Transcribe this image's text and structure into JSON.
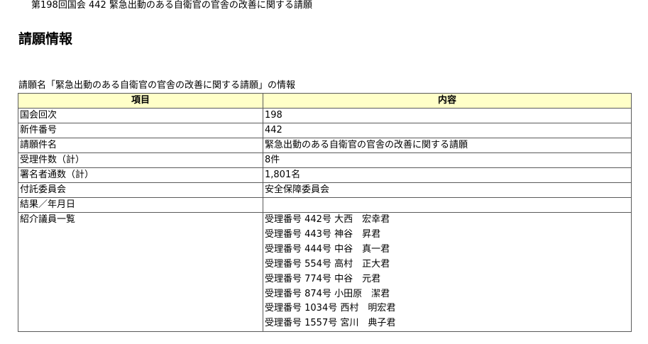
{
  "page": {
    "top_title": "第198回国会 442 緊急出動のある自衛官の官舎の改善に関する請願",
    "heading": "請願情報",
    "caption": "請願名「緊急出動のある自衛官の官舎の改善に関する請願」の情報"
  },
  "table": {
    "headers": {
      "item": "項目",
      "content": "内容"
    },
    "rows": [
      {
        "item": "国会回次",
        "content": "198"
      },
      {
        "item": "新件番号",
        "content": "442"
      },
      {
        "item": "請願件名",
        "content": "緊急出動のある自衛官の官舎の改善に関する請願"
      },
      {
        "item": "受理件数（計）",
        "content": "8件"
      },
      {
        "item": "署名者通数（計）",
        "content": "1,801名"
      },
      {
        "item": "付託委員会",
        "content": "安全保障委員会"
      },
      {
        "item": "結果／年月日",
        "content": ""
      }
    ],
    "members_row": {
      "item": "紹介議員一覧",
      "entries": [
        "受理番号 442号 大西　宏幸君",
        "受理番号 443号 神谷　昇君",
        "受理番号 444号 中谷　真一君",
        "受理番号 554号 高村　正大君",
        "受理番号 774号 中谷　元君",
        "受理番号 874号 小田原　潔君",
        "受理番号 1034号 西村　明宏君",
        "受理番号 1557号 宮川　典子君"
      ]
    }
  },
  "colors": {
    "header_background": "#ffffc8",
    "border": "#5a5a5a"
  }
}
